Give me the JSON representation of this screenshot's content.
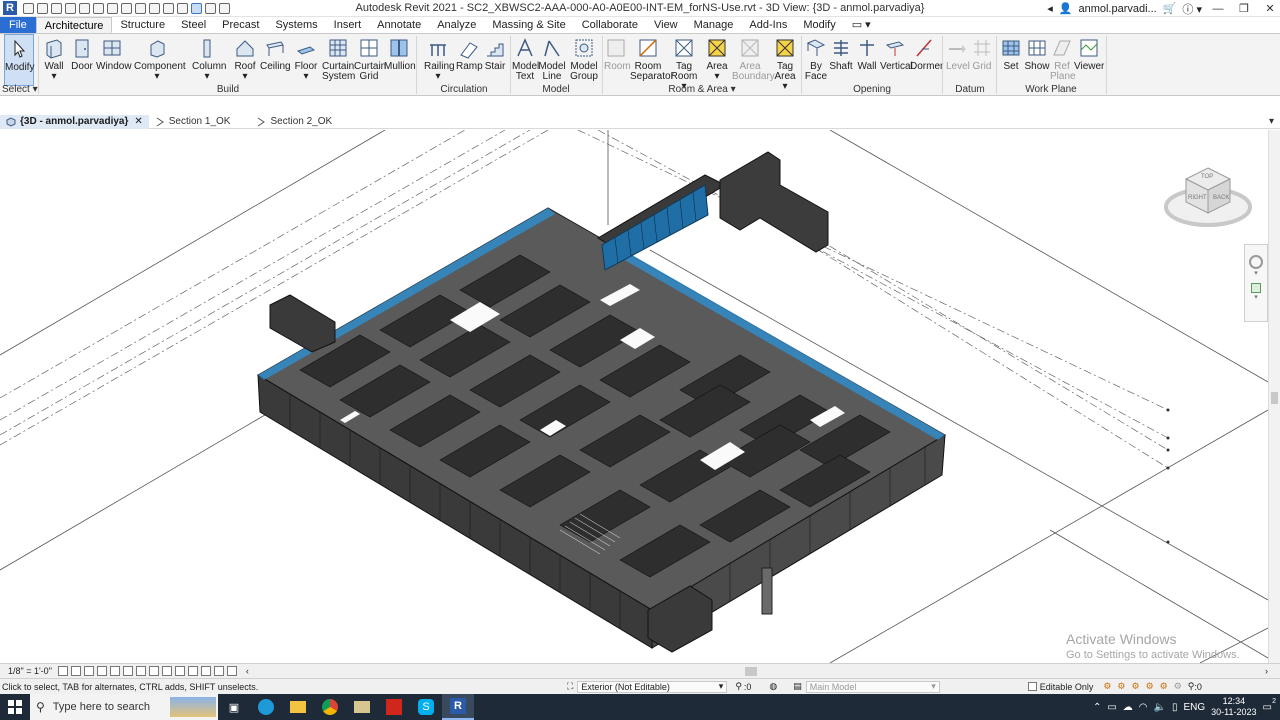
{
  "titlebar": {
    "logo": "R",
    "title": "Autodesk Revit 2021 - SC2_XBWSC2-AAA-000-A0-A0E00-INT-EM_forNS-Use.rvt - 3D View: {3D - anmol.parvadiya}",
    "user": "anmol.parvadi..."
  },
  "ribbon_tabs": [
    "File",
    "Architecture",
    "Structure",
    "Steel",
    "Precast",
    "Systems",
    "Insert",
    "Annotate",
    "Analyze",
    "Massing & Site",
    "Collaborate",
    "View",
    "Manage",
    "Add-Ins",
    "Modify"
  ],
  "ribbon": {
    "select_label": "Select",
    "panels": [
      "Build",
      "Circulation",
      "Model",
      "Room & Area",
      "Opening",
      "Datum",
      "Work Plane"
    ],
    "buttons": {
      "modify": "Modify",
      "wall": "Wall",
      "door": "Door",
      "window": "Window",
      "component": "Component",
      "column": "Column",
      "roof": "Roof",
      "ceiling": "Ceiling",
      "floor": "Floor",
      "curtain_system_1": "Curtain",
      "curtain_system_2": "System",
      "curtain_grid_1": "Curtain",
      "curtain_grid_2": "Grid",
      "mullion": "Mullion",
      "railing": "Railing",
      "ramp": "Ramp",
      "stair": "Stair",
      "model_text_1": "Model",
      "model_text_2": "Text",
      "model_line_1": "Model",
      "model_line_2": "Line",
      "model_group_1": "Model",
      "model_group_2": "Group",
      "room": "Room",
      "room_sep_1": "Room",
      "room_sep_2": "Separator",
      "tag_room_1": "Tag",
      "tag_room_2": "Room",
      "area": "Area",
      "area_boundary_1": "Area",
      "area_boundary_2": "Boundary",
      "tag_area_1": "Tag",
      "tag_area_2": "Area",
      "by_face_1": "By",
      "by_face_2": "Face",
      "shaft": "Shaft",
      "wall_opening": "Wall",
      "vertical": "Vertical",
      "dormer": "Dormer",
      "level": "Level",
      "grid": "Grid",
      "set": "Set",
      "show": "Show",
      "ref_plane_1": "Ref",
      "ref_plane_2": "Plane",
      "viewer": "Viewer"
    }
  },
  "view_tabs": [
    {
      "label": "{3D - anmol.parvadiya}",
      "active": true
    },
    {
      "label": "Section 1_OK",
      "active": false
    },
    {
      "label": "Section 2_OK",
      "active": false
    }
  ],
  "viewcube": {
    "top": "TOP",
    "front": "RIGHT",
    "side": "BACK"
  },
  "watermark": {
    "line1": "Activate Windows",
    "line2": "Go to Settings to activate Windows."
  },
  "view_control": {
    "scale": "1/8\" = 1'-0\""
  },
  "statusbar": {
    "message": "Click to select, TAB for alternates, CTRL adds, SHIFT unselects.",
    "workset": "Exterior (Not Editable)",
    "filter_count": ":0",
    "design_option": "Main Model",
    "editable_only": "Editable Only",
    "selection_count": ":0"
  },
  "taskbar": {
    "search_placeholder": "Type here to search",
    "lang": "ENG",
    "time": "12:34",
    "date": "30-11-2023",
    "notification_count": "2"
  },
  "colors": {
    "accent": "#2a6ed3",
    "taskbar": "#1f2a38",
    "ribbon": "#f3f3f3",
    "glazing": "#2e8fd0"
  }
}
